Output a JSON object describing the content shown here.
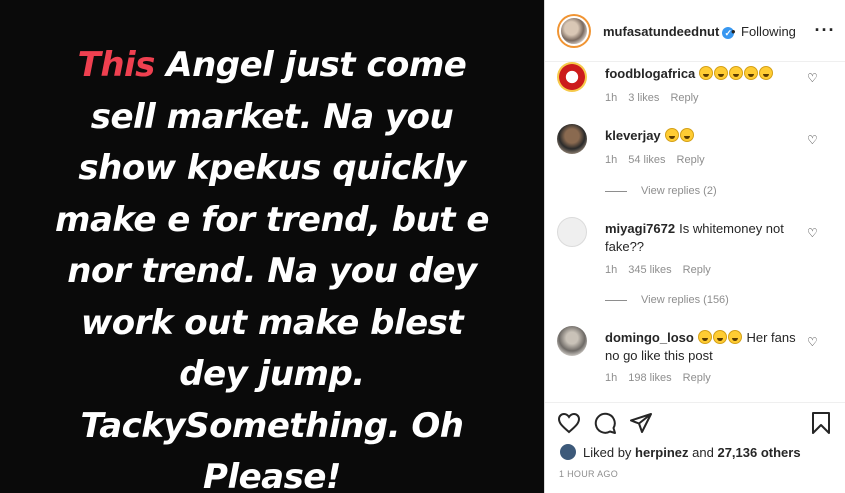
{
  "post": {
    "lines": [
      {
        "highlight": "This",
        "rest": " Angel just come"
      },
      {
        "highlight": "",
        "rest": "sell market. Na you"
      },
      {
        "highlight": "",
        "rest": "show kpekus quickly"
      },
      {
        "highlight": "",
        "rest": "make e for trend, but e"
      },
      {
        "highlight": "",
        "rest": "nor trend. Na you dey"
      },
      {
        "highlight": "",
        "rest": "work out make blest"
      },
      {
        "highlight": "",
        "rest": "dey jump."
      },
      {
        "highlight": "",
        "rest": "TackySomething. Oh"
      },
      {
        "highlight": "",
        "rest": "Please!"
      }
    ]
  },
  "header": {
    "username": "mufasatundeednut",
    "separator": "•",
    "follow_status": "Following",
    "verified_icon": "verified-badge-icon",
    "more_icon": "more-options-icon"
  },
  "comments": [
    {
      "username": "foodblogafrica",
      "text": "",
      "emojis": 5,
      "time": "1h",
      "likes": "3 likes",
      "reply": "Reply"
    },
    {
      "username": "kleverjay",
      "text": "",
      "emojis": 2,
      "time": "1h",
      "likes": "54 likes",
      "reply": "Reply",
      "view_replies": "View replies (2)"
    },
    {
      "username": "miyagi7672",
      "text": "Is whitemoney not fake??",
      "emojis": 0,
      "time": "1h",
      "likes": "345 likes",
      "reply": "Reply",
      "view_replies": "View replies (156)"
    },
    {
      "username": "domingo_loso",
      "text": "Her fans no go like this post",
      "emojis": 3,
      "time": "1h",
      "likes": "198 likes",
      "reply": "Reply"
    }
  ],
  "actions": {
    "liked_prefix": "Liked by",
    "liked_user": "herpinez",
    "liked_and": "and",
    "liked_others": "27,136 others",
    "time_ago": "1 HOUR AGO"
  },
  "colors": {
    "accent_red": "#ef4050",
    "verified_blue": "#3897f0"
  }
}
